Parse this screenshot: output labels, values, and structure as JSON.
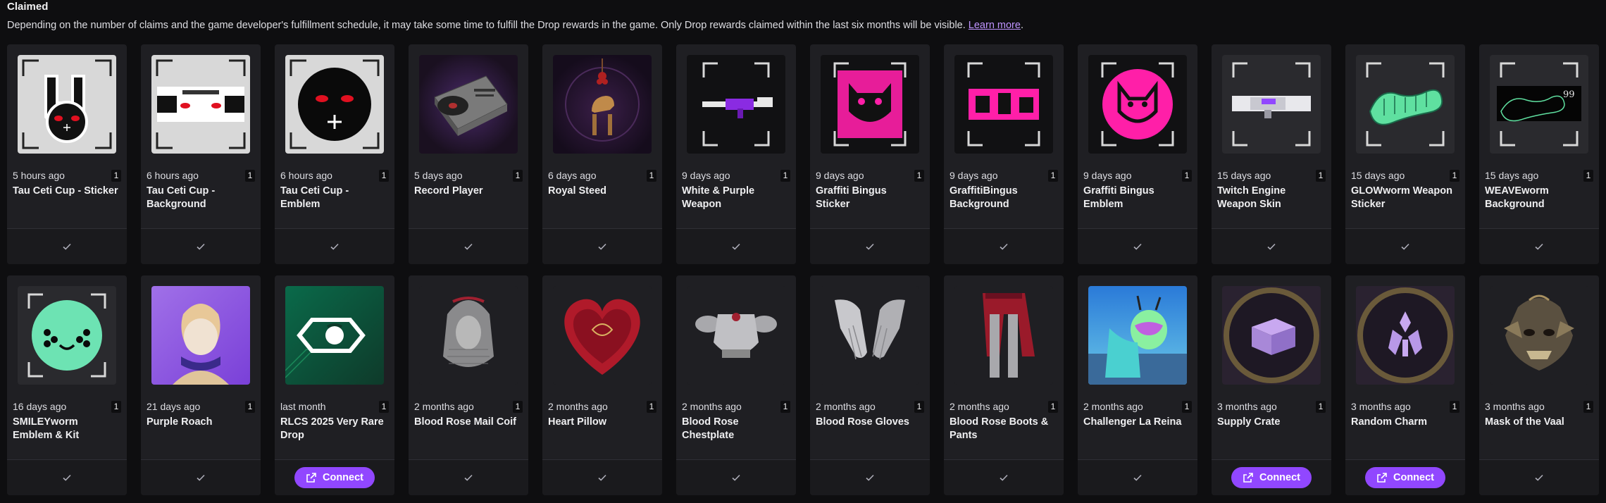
{
  "header": {
    "title": "Claimed",
    "description": "Depending on the number of claims and the game developer's fulfillment schedule, it may take some time to fulfill the Drop rewards in the game. Only Drop rewards claimed within the last six months will be visible. ",
    "learn_more": "Learn more",
    "period": "."
  },
  "connect_label": "Connect",
  "accent_color": "#9147ff",
  "link_color": "#bf94ff",
  "cards": [
    {
      "time": "5 hours ago",
      "qty": "1",
      "name": "Tau Ceti Cup - Sticker",
      "status": "claimed"
    },
    {
      "time": "6 hours ago",
      "qty": "1",
      "name": "Tau Ceti Cup - Background",
      "status": "claimed"
    },
    {
      "time": "6 hours ago",
      "qty": "1",
      "name": "Tau Ceti Cup - Emblem",
      "status": "claimed"
    },
    {
      "time": "5 days ago",
      "qty": "1",
      "name": "Record Player",
      "status": "claimed"
    },
    {
      "time": "6 days ago",
      "qty": "1",
      "name": "Royal Steed",
      "status": "claimed"
    },
    {
      "time": "9 days ago",
      "qty": "1",
      "name": "White & Purple Weapon",
      "status": "claimed"
    },
    {
      "time": "9 days ago",
      "qty": "1",
      "name": "Graffiti Bingus Sticker",
      "status": "claimed"
    },
    {
      "time": "9 days ago",
      "qty": "1",
      "name": "GraffitiBingus Background",
      "status": "claimed"
    },
    {
      "time": "9 days ago",
      "qty": "1",
      "name": "Graffiti Bingus Emblem",
      "status": "claimed"
    },
    {
      "time": "15 days ago",
      "qty": "1",
      "name": "Twitch Engine Weapon Skin",
      "status": "claimed"
    },
    {
      "time": "15 days ago",
      "qty": "1",
      "name": "GLOWworm Weapon Sticker",
      "status": "claimed"
    },
    {
      "time": "15 days ago",
      "qty": "1",
      "name": "WEAVEworm Background",
      "status": "claimed"
    },
    {
      "time": "16 days ago",
      "qty": "1",
      "name": "SMILEYworm Emblem & Kit",
      "status": "claimed"
    },
    {
      "time": "21 days ago",
      "qty": "1",
      "name": "Purple Roach",
      "status": "claimed"
    },
    {
      "time": "last month",
      "qty": "1",
      "name": "RLCS 2025 Very Rare Drop",
      "status": "connect"
    },
    {
      "time": "2 months ago",
      "qty": "1",
      "name": "Blood Rose Mail Coif",
      "status": "claimed"
    },
    {
      "time": "2 months ago",
      "qty": "1",
      "name": "Heart Pillow",
      "status": "claimed"
    },
    {
      "time": "2 months ago",
      "qty": "1",
      "name": "Blood Rose Chestplate",
      "status": "claimed"
    },
    {
      "time": "2 months ago",
      "qty": "1",
      "name": "Blood Rose Gloves",
      "status": "claimed"
    },
    {
      "time": "2 months ago",
      "qty": "1",
      "name": "Blood Rose Boots & Pants",
      "status": "claimed"
    },
    {
      "time": "2 months ago",
      "qty": "1",
      "name": "Challenger La Reina",
      "status": "claimed"
    },
    {
      "time": "3 months ago",
      "qty": "1",
      "name": "Supply Crate",
      "status": "connect"
    },
    {
      "time": "3 months ago",
      "qty": "1",
      "name": "Random Charm",
      "status": "connect"
    },
    {
      "time": "3 months ago",
      "qty": "1",
      "name": "Mask of the Vaal",
      "status": "claimed"
    }
  ]
}
